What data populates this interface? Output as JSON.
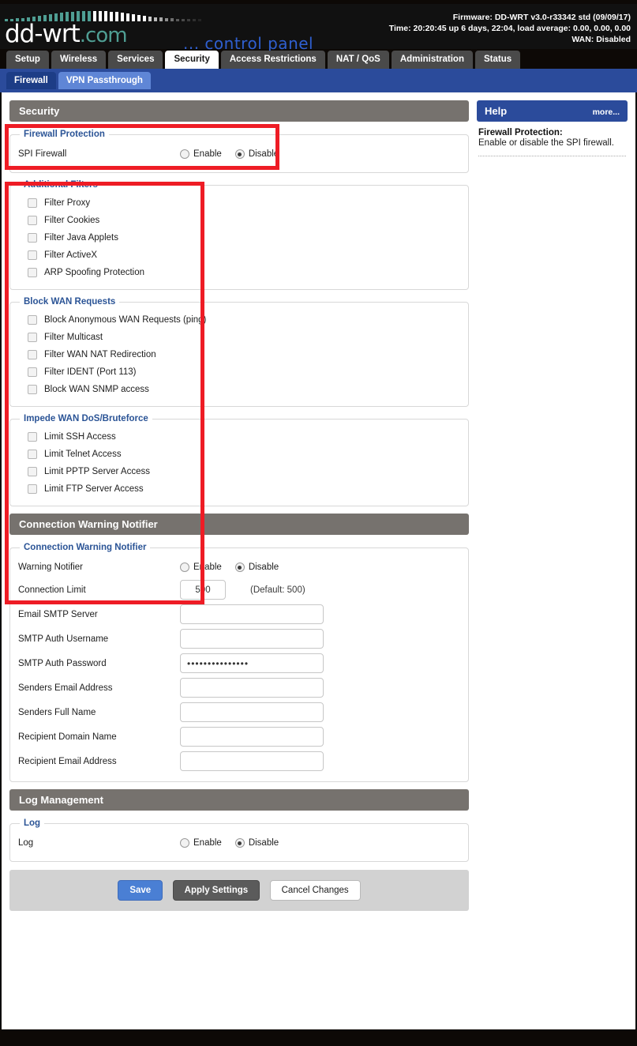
{
  "brand": {
    "logo_main": "dd-wrt",
    "logo_domain": ".com",
    "tagline": "... control panel"
  },
  "sysinfo": {
    "firmware": "Firmware: DD-WRT v3.0-r33342 std (09/09/17)",
    "time": "Time: 20:20:45 up 6 days, 22:04, load average: 0.00, 0.00, 0.00",
    "wan": "WAN: Disabled"
  },
  "nav": {
    "tabs": [
      {
        "label": "Setup",
        "active": false
      },
      {
        "label": "Wireless",
        "active": false
      },
      {
        "label": "Services",
        "active": false
      },
      {
        "label": "Security",
        "active": true
      },
      {
        "label": "Access Restrictions",
        "active": false
      },
      {
        "label": "NAT / QoS",
        "active": false
      },
      {
        "label": "Administration",
        "active": false
      },
      {
        "label": "Status",
        "active": false
      }
    ],
    "subtabs": [
      {
        "label": "Firewall",
        "active": true
      },
      {
        "label": "VPN Passthrough",
        "active": false
      }
    ]
  },
  "sections": {
    "security_bar": "Security",
    "firewall_protection": {
      "legend": "Firewall Protection",
      "spi_label": "SPI Firewall",
      "enable_label": "Enable",
      "disable_label": "Disable",
      "value": "Disable"
    },
    "additional_filters": {
      "legend": "Additional Filters",
      "items": [
        {
          "label": "Filter Proxy",
          "checked": false
        },
        {
          "label": "Filter Cookies",
          "checked": false
        },
        {
          "label": "Filter Java Applets",
          "checked": false
        },
        {
          "label": "Filter ActiveX",
          "checked": false
        },
        {
          "label": "ARP Spoofing Protection",
          "checked": false
        }
      ]
    },
    "block_wan_requests": {
      "legend": "Block WAN Requests",
      "items": [
        {
          "label": "Block Anonymous WAN Requests (ping)",
          "checked": false
        },
        {
          "label": "Filter Multicast",
          "checked": false
        },
        {
          "label": "Filter WAN NAT Redirection",
          "checked": false
        },
        {
          "label": "Filter IDENT (Port 113)",
          "checked": false
        },
        {
          "label": "Block WAN SNMP access",
          "checked": false
        }
      ]
    },
    "impede_dos": {
      "legend": "Impede WAN DoS/Bruteforce",
      "items": [
        {
          "label": "Limit SSH Access",
          "checked": false
        },
        {
          "label": "Limit Telnet Access",
          "checked": false
        },
        {
          "label": "Limit PPTP Server Access",
          "checked": false
        },
        {
          "label": "Limit FTP Server Access",
          "checked": false
        }
      ]
    },
    "connection_warning_notifier": {
      "bar": "Connection Warning Notifier",
      "legend": "Connection Warning Notifier",
      "notifier_label": "Warning Notifier",
      "enable_label": "Enable",
      "disable_label": "Disable",
      "notifier_value": "Disable",
      "fields": [
        {
          "label": "Connection Limit",
          "value": "500",
          "placeholder": "",
          "hint": "(Default: 500)",
          "size": "small",
          "masked": false
        },
        {
          "label": "Email SMTP Server",
          "value": "",
          "placeholder": "",
          "hint": "",
          "size": "wide",
          "masked": false
        },
        {
          "label": "SMTP Auth Username",
          "value": "",
          "placeholder": "",
          "hint": "",
          "size": "wide",
          "masked": false
        },
        {
          "label": "SMTP Auth Password",
          "value": "•••••••••••••••",
          "placeholder": "",
          "hint": "",
          "size": "wide",
          "masked": true
        },
        {
          "label": "Senders Email Address",
          "value": "",
          "placeholder": "",
          "hint": "",
          "size": "wide",
          "masked": false
        },
        {
          "label": "Senders Full Name",
          "value": "",
          "placeholder": "",
          "hint": "",
          "size": "wide",
          "masked": false
        },
        {
          "label": "Recipient Domain Name",
          "value": "",
          "placeholder": "",
          "hint": "",
          "size": "wide",
          "masked": false
        },
        {
          "label": "Recipient Email Address",
          "value": "",
          "placeholder": "",
          "hint": "",
          "size": "wide",
          "masked": false
        }
      ]
    },
    "log_management": {
      "bar": "Log Management",
      "legend": "Log",
      "log_label": "Log",
      "enable_label": "Enable",
      "disable_label": "Disable",
      "value": "Disable"
    }
  },
  "buttons": {
    "save": "Save",
    "apply": "Apply Settings",
    "cancel": "Cancel Changes"
  },
  "help": {
    "title": "Help",
    "more": "more...",
    "term": "Firewall Protection:",
    "description": "Enable or disable the SPI firewall."
  },
  "colors": {
    "accent_blue": "#2b4b9b",
    "tab_active": "#ffffff",
    "bar_gray": "#76726e",
    "legend_blue": "#2b5496",
    "annotation_red": "#ee1c25",
    "logo_teal": "#4f9e93"
  }
}
